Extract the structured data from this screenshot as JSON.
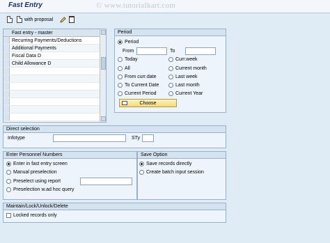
{
  "window": {
    "title": "Fast Entry",
    "watermark": "© www.tutorialkart.com"
  },
  "toolbar": {
    "with_proposal_label": "with proposal"
  },
  "list": {
    "header": "Fast entry - master",
    "items": [
      "Recurring Payments/Deductions",
      "Additional Payments",
      "Fiscal Data  D",
      "Child Allowance  D"
    ]
  },
  "period": {
    "title": "Period",
    "period_label": "Period",
    "from_label": "From",
    "to_label": "To",
    "from_value": "",
    "to_value": "",
    "options_left": [
      "Today",
      "All",
      "From curr.date",
      "To Current Date",
      "Current Period"
    ],
    "options_right": [
      "Curr.week",
      "Current month",
      "Last week",
      "Last month",
      "Current Year"
    ],
    "choose_label": "Choose"
  },
  "direct_selection": {
    "title": "Direct selection",
    "infotype_label": "Infotype",
    "infotype_value": "",
    "sty_label": "STy",
    "sty_value": ""
  },
  "personnel": {
    "title": "Enter Personnel Numbers",
    "options": [
      "Enter in fast entry screen",
      "Manual preselection",
      "Preselect using report",
      "Preselection w.ad hoc query"
    ],
    "report_value": ""
  },
  "save": {
    "title": "Save Option",
    "options": [
      "Save records directly",
      "Create batch input session"
    ]
  },
  "maintain": {
    "title": "Maintain/Lock/Unlock/Delete",
    "locked_label": "Locked records only"
  }
}
